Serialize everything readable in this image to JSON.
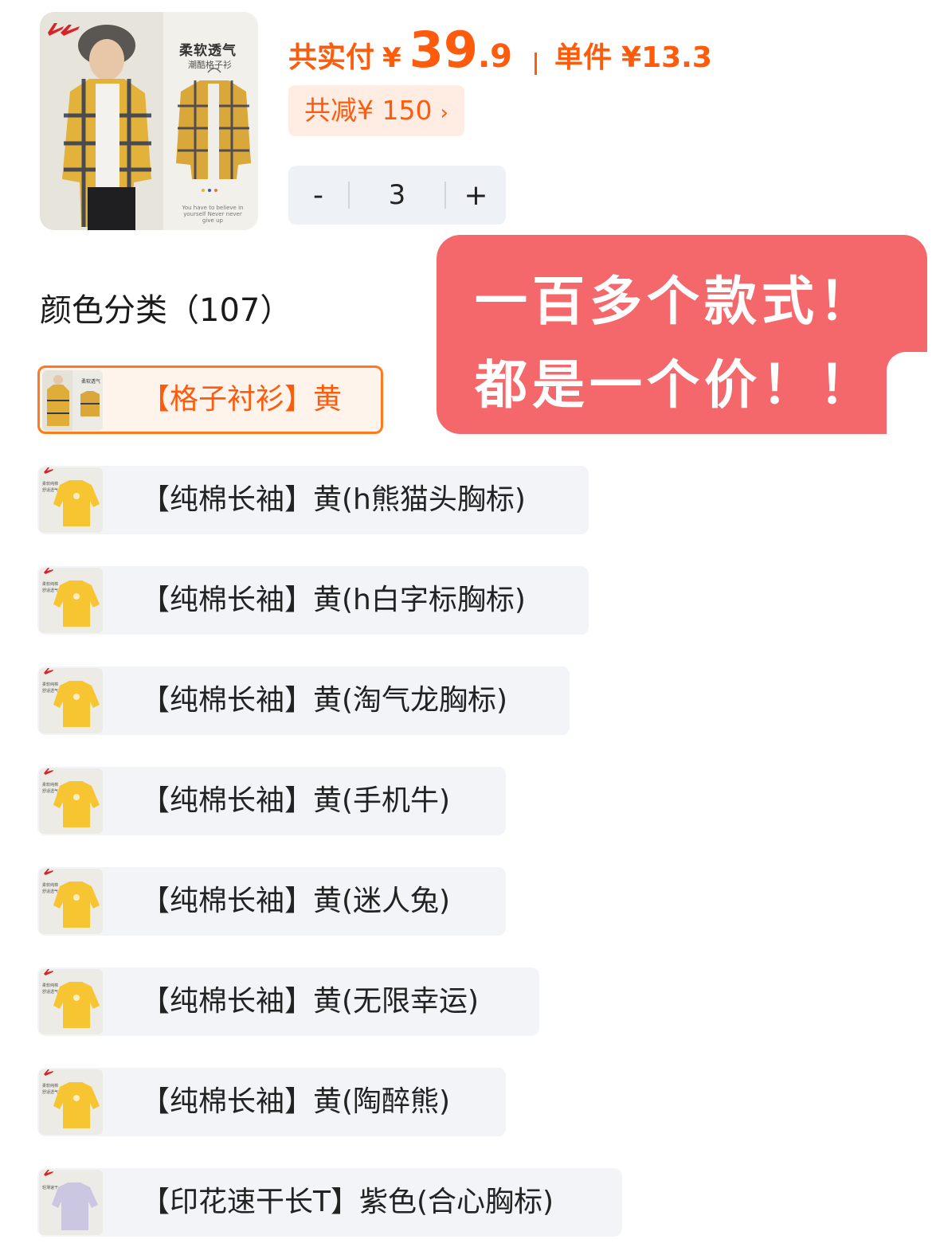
{
  "product": {
    "image_icon": "product-image",
    "banner_title": "柔软透气",
    "banner_sub": "潮酷格子衫",
    "banner_tagline": "You have to believe in yourself Never never give up"
  },
  "price": {
    "label": "共实付",
    "yen": "¥",
    "integer": "39",
    "decimal": ".9",
    "unit_label": "单件",
    "unit_value": "¥13.3"
  },
  "discount": {
    "label": "共减",
    "amount": "¥ 150",
    "chevron": "›"
  },
  "stepper": {
    "minus": "-",
    "quantity": "3",
    "plus": "+"
  },
  "section": {
    "title": "颜色分类（107）"
  },
  "annotation": {
    "line1": "一百多个款式！",
    "line2": "都是一个价！！"
  },
  "colors": {
    "accent": "#ff5b0c",
    "chip_bg": "#ffece2",
    "option_bg": "#f2f4f7",
    "annotation_bg": "#f4676a",
    "yellow_tee": "#f6c531",
    "purple_tee": "#cbc7e2"
  },
  "variants": [
    {
      "label": "【格子衬衫】黄",
      "selected": true,
      "thumb": "plaid-shirt"
    },
    {
      "label": "【纯棉长袖】黄(h熊猫头胸标)",
      "selected": false,
      "thumb": "yellow-tee"
    },
    {
      "label": "【纯棉长袖】黄(h白字标胸标)",
      "selected": false,
      "thumb": "yellow-tee"
    },
    {
      "label": "【纯棉长袖】黄(淘气龙胸标)",
      "selected": false,
      "thumb": "yellow-tee"
    },
    {
      "label": "【纯棉长袖】黄(手机牛)",
      "selected": false,
      "thumb": "yellow-tee"
    },
    {
      "label": "【纯棉长袖】黄(迷人兔)",
      "selected": false,
      "thumb": "yellow-tee"
    },
    {
      "label": "【纯棉长袖】黄(无限幸运)",
      "selected": false,
      "thumb": "yellow-tee"
    },
    {
      "label": "【纯棉长袖】黄(陶醉熊)",
      "selected": false,
      "thumb": "yellow-tee"
    },
    {
      "label": "【印花速干长T】紫色(合心胸标)",
      "selected": false,
      "thumb": "purple-tee"
    }
  ]
}
